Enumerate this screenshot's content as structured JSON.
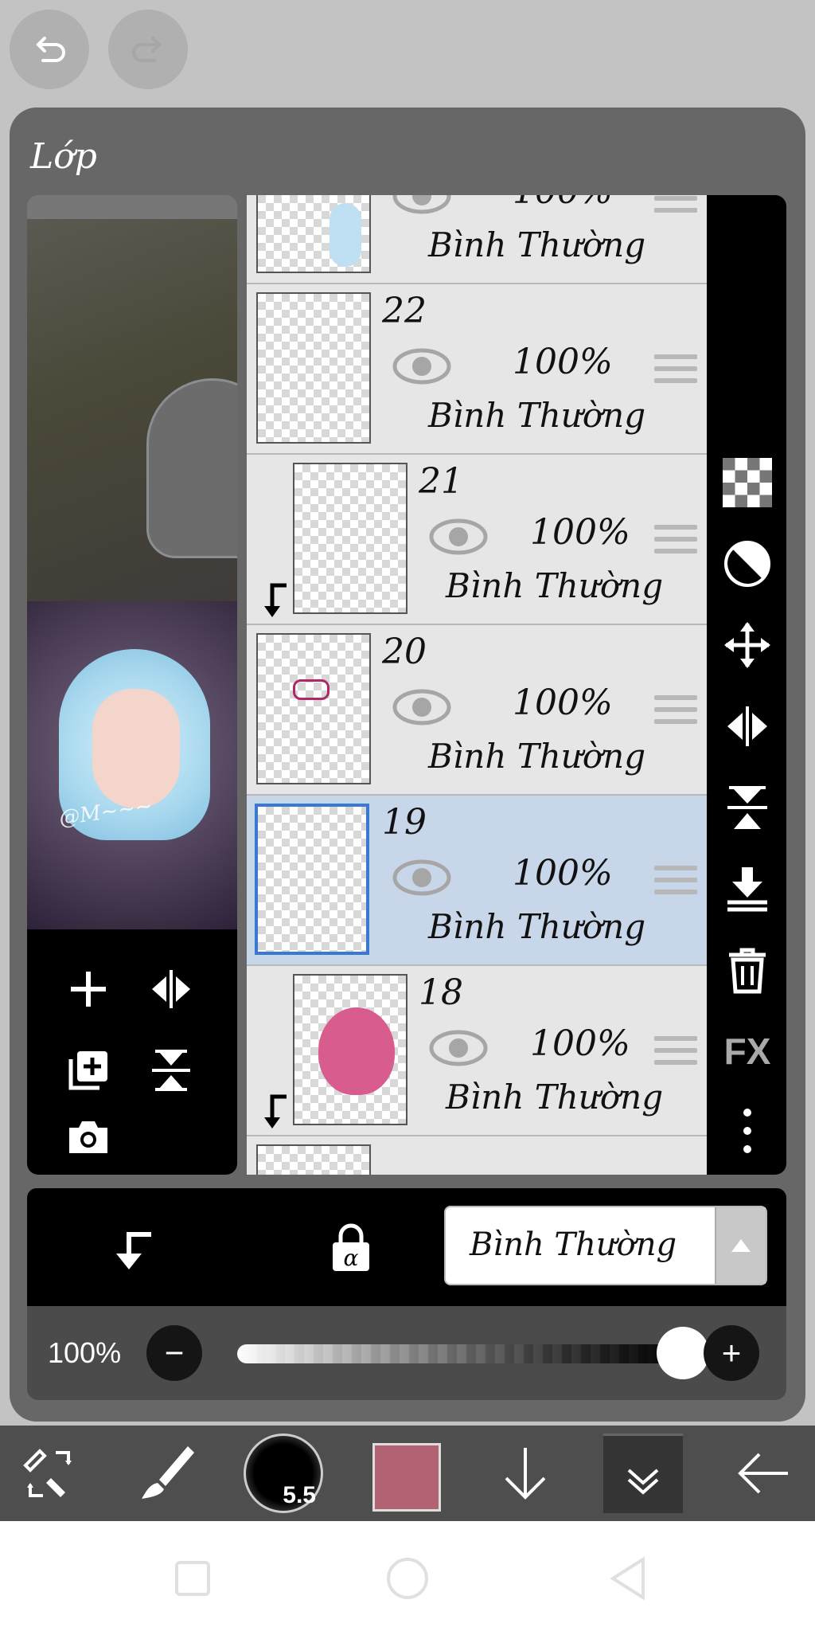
{
  "panel": {
    "title": "Lớp"
  },
  "layers": [
    {
      "num": "",
      "opacity": "100%",
      "blend": "Bình Thường"
    },
    {
      "num": "22",
      "opacity": "100%",
      "blend": "Bình Thường"
    },
    {
      "num": "21",
      "opacity": "100%",
      "blend": "Bình Thường"
    },
    {
      "num": "20",
      "opacity": "100%",
      "blend": "Bình Thường"
    },
    {
      "num": "19",
      "opacity": "100%",
      "blend": "Bình Thường"
    },
    {
      "num": "18",
      "opacity": "100%",
      "blend": "Bình Thường"
    }
  ],
  "iconbar": {
    "fx": "FX"
  },
  "blend_bar": {
    "mode": "Bình Thường"
  },
  "opacity_row": {
    "value": "100%",
    "minus": "−",
    "plus": "+"
  },
  "toolbar": {
    "brush_size": "5.5",
    "color": "#b36274"
  },
  "accent": "#3a79d0",
  "selected_layer": "19",
  "opacity_fraction": 1.0
}
